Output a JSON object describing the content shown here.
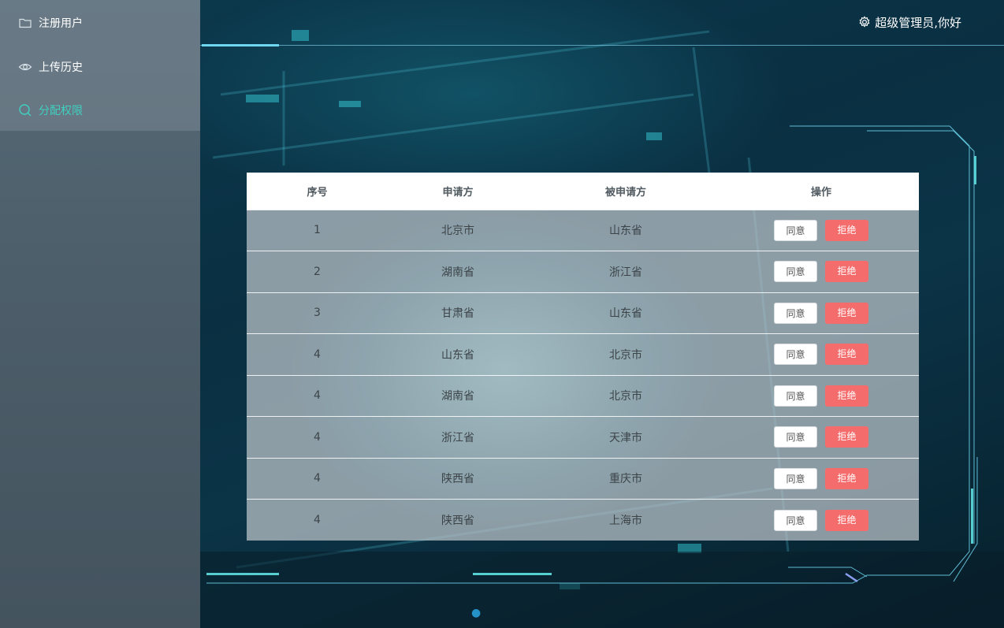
{
  "sidebar": {
    "items": [
      {
        "label": "注册用户",
        "icon": "folder-icon",
        "active": false
      },
      {
        "label": "上传历史",
        "icon": "eye-icon",
        "active": false
      },
      {
        "label": "分配权限",
        "icon": "search-icon",
        "active": true
      }
    ]
  },
  "header": {
    "greeting": "超级管理员,你好",
    "icon": "gear-icon"
  },
  "table": {
    "headers": [
      "序号",
      "申请方",
      "被申请方",
      "操作"
    ],
    "rows": [
      {
        "index": "1",
        "applicant": "北京市",
        "target": "山东省"
      },
      {
        "index": "2",
        "applicant": "湖南省",
        "target": "浙江省"
      },
      {
        "index": "3",
        "applicant": "甘肃省",
        "target": "山东省"
      },
      {
        "index": "4",
        "applicant": "山东省",
        "target": "北京市"
      },
      {
        "index": "4",
        "applicant": "湖南省",
        "target": "北京市"
      },
      {
        "index": "4",
        "applicant": "浙江省",
        "target": "天津市"
      },
      {
        "index": "4",
        "applicant": "陕西省",
        "target": "重庆市"
      },
      {
        "index": "4",
        "applicant": "陕西省",
        "target": "上海市"
      }
    ],
    "agree_label": "同意",
    "reject_label": "拒绝"
  },
  "colors": {
    "accent": "#3fd0c0",
    "reject": "#f56c6c",
    "frame_line": "#6fd7f0"
  }
}
